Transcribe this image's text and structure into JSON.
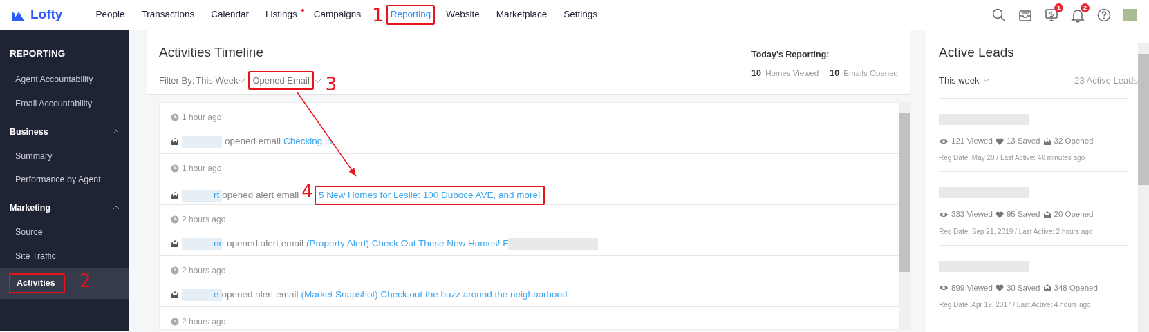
{
  "brand": {
    "name": "Lofty"
  },
  "nav": [
    {
      "label": "People",
      "selected": false
    },
    {
      "label": "Transactions",
      "selected": false
    },
    {
      "label": "Calendar",
      "selected": false
    },
    {
      "label": "Listings",
      "selected": false,
      "dot": true
    },
    {
      "label": "Campaigns",
      "selected": false
    },
    {
      "label": "Reporting",
      "selected": true,
      "callout": "1"
    },
    {
      "label": "Website",
      "selected": false
    },
    {
      "label": "Marketplace",
      "selected": false
    },
    {
      "label": "Settings",
      "selected": false
    }
  ],
  "toolbar": [
    {
      "kind": "search"
    },
    {
      "kind": "inbox"
    },
    {
      "kind": "dollar",
      "badge": "1"
    },
    {
      "kind": "bell",
      "badge": "2"
    },
    {
      "kind": "help"
    },
    {
      "kind": "avatar"
    }
  ],
  "sidebar": {
    "title": "REPORTING",
    "groups": [
      {
        "items": [
          {
            "label": "Agent Accountability",
            "selected": false
          },
          {
            "label": "Email Accountability",
            "selected": false
          }
        ]
      },
      {
        "label": "Business",
        "expanded": true,
        "items": [
          {
            "label": "Summary",
            "selected": false
          },
          {
            "label": "Performance by Agent",
            "selected": false
          }
        ]
      },
      {
        "label": "Marketing",
        "expanded": true,
        "items": [
          {
            "label": "Source",
            "selected": false
          },
          {
            "label": "Site Traffic",
            "selected": false
          },
          {
            "label": "Activities",
            "selected": true,
            "callout": "2"
          }
        ]
      }
    ]
  },
  "timeline": {
    "title": "Activities Timeline",
    "filter_label": "Filter By:",
    "filters": [
      {
        "label": "This Week"
      },
      {
        "label": "Opened Email",
        "callout": "3"
      }
    ],
    "today": {
      "title": "Today's Reporting:",
      "stats": [
        "**10** Homes Viewed",
        "**10** Emails Opened"
      ]
    },
    "arrow": true,
    "rows": [
      {
        "time": "1 hour ago",
        "action": "opened email",
        "link": "Checking in"
      },
      {
        "time": "1 hour ago",
        "actor": "rt",
        "action": "opened alert email",
        "link": "5 New Homes for Leslie: 100 Duboce AVE, and more!",
        "callout": "4"
      },
      {
        "time": "2 hours ago",
        "actor": "ne",
        "action": "opened alert email",
        "link": "(Property Alert) Check Out These New Homes! F"
      },
      {
        "time": "2 hours ago",
        "actor": "e",
        "action": "opened alert email",
        "link": "(Market Snapshot) Check out the buzz around the neighborhood"
      },
      {
        "time": "2 hours ago"
      }
    ]
  },
  "leads": {
    "title": "Active Leads",
    "period": "This week",
    "count": "23 Active Leads",
    "items": [
      {
        "viewed": "121 Viewed",
        "saved": "13 Saved",
        "opened": "32 Opened",
        "meta": "Reg Date: May 20 / Last Active: 40 minutes ago"
      },
      {
        "viewed": "333 Viewed",
        "saved": "95 Saved",
        "opened": "20 Opened",
        "meta": "Reg Date: Sep 21, 2019 / Last Active: 2 hours ago"
      },
      {
        "viewed": "899 Viewed",
        "saved": "30 Saved",
        "opened": "348 Opened",
        "meta": "Reg Date: Apr 19, 2017 / Last Active: 4 hours ago"
      }
    ]
  }
}
